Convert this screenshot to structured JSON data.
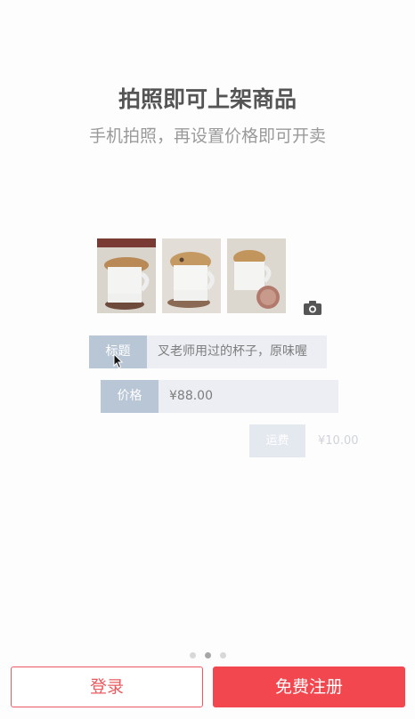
{
  "header": {
    "title": "拍照即可上架商品",
    "subtitle": "手机拍照，再设置价格即可开卖"
  },
  "photos": [
    "cup-photo-1",
    "cup-photo-2",
    "cup-photo-3"
  ],
  "form": {
    "title_label": "标题",
    "title_value": "叉老师用过的杯子，原味喔",
    "price_label": "价格",
    "price_value": "¥88.00",
    "shipping_label": "运费",
    "shipping_value": "¥10.00"
  },
  "pager": {
    "total": 3,
    "active": 2
  },
  "buttons": {
    "login": "登录",
    "register": "免费注册"
  },
  "colors": {
    "accent": "#f2474e",
    "label_bg": "#b9c6d6"
  }
}
